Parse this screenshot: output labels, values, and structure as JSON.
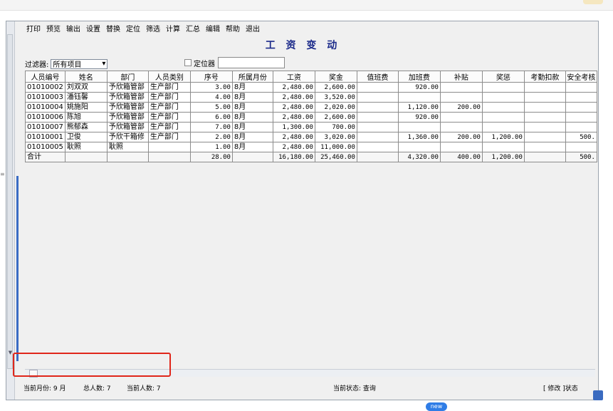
{
  "menu": [
    "打印",
    "预览",
    "输出",
    "设置",
    "替换",
    "定位",
    "筛选",
    "计算",
    "汇总",
    "编辑",
    "帮助",
    "退出"
  ],
  "title": "工 资 变 动",
  "filter": {
    "label": "过滤器:",
    "value": "所有项目",
    "caret": "▾"
  },
  "locator": {
    "label": "定位器",
    "value": ""
  },
  "columns": [
    "人员编号",
    "姓名",
    "部门",
    "人员类别",
    "序号",
    "所属月份",
    "工资",
    "奖金",
    "值班费",
    "加班费",
    "补贴",
    "奖惩",
    "考勤扣款",
    "安全考核"
  ],
  "rows": [
    [
      "01010002",
      "刘双双",
      "予欣箱管部",
      "生产部门",
      "3.00",
      "8月",
      "2,480.00",
      "2,600.00",
      "",
      "920.00",
      "",
      "",
      "",
      ""
    ],
    [
      "01010003",
      "潘钰馨",
      "予欣箱管部",
      "生产部门",
      "4.00",
      "8月",
      "2,480.00",
      "3,520.00",
      "",
      "",
      "",
      "",
      "",
      ""
    ],
    [
      "01010004",
      "姚施阳",
      "予欣箱管部",
      "生产部门",
      "5.00",
      "8月",
      "2,480.00",
      "2,020.00",
      "",
      "1,120.00",
      "200.00",
      "",
      "",
      ""
    ],
    [
      "01010006",
      "陈旭",
      "予欣箱管部",
      "生产部门",
      "6.00",
      "8月",
      "2,480.00",
      "2,600.00",
      "",
      "920.00",
      "",
      "",
      "",
      ""
    ],
    [
      "01010007",
      "熊郁森",
      "予欣箱管部",
      "生产部门",
      "7.00",
      "8月",
      "1,300.00",
      "700.00",
      "",
      "",
      "",
      "",
      "",
      ""
    ],
    [
      "01010001",
      "卫俊",
      "予欣干箱修",
      "生产部门",
      "2.00",
      "8月",
      "2,480.00",
      "3,020.00",
      "",
      "1,360.00",
      "200.00",
      "1,200.00",
      "",
      "500."
    ],
    [
      "01010005",
      "耿照",
      "耿照",
      "",
      "1.00",
      "8月",
      "2,480.00",
      "11,000.00",
      "",
      "",
      "",
      "",
      "",
      ""
    ]
  ],
  "total": [
    "合计",
    "",
    "",
    "",
    "28.00",
    "",
    "16,180.00",
    "25,460.00",
    "",
    "4,320.00",
    "400.00",
    "1,200.00",
    "",
    "500."
  ],
  "status": {
    "current_month": "当前月份: 9 月",
    "total_people": "总人数: 7",
    "current_people": "当前人数: 7",
    "current_state": "当前状态: 查询",
    "mode": "[ 修改 ]状态"
  },
  "badge": "new",
  "icons": {
    "up": "▲",
    "down": "▼",
    "edge": "≡"
  }
}
